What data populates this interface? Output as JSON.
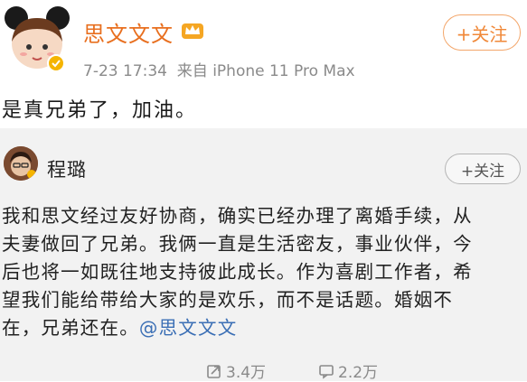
{
  "main_post": {
    "username": "思文文文",
    "follow_label": "+关注",
    "time": "7-23 17:34",
    "source": "来自 iPhone 11 Pro Max",
    "text": "是真兄弟了，加油。"
  },
  "repost": {
    "username": "程璐",
    "follow_label": "+关注",
    "lines": [
      "我和思文经过友好协商，确实已经办理了离婚手续，从",
      "夫妻做回了兄弟。我俩一直是生活密友，事业伙伴，今",
      "后也将一如既往地支持彼此成长。作为喜剧工作者，希",
      "望我们能给带给大家的是欢乐，而不是话题。婚姻不"
    ],
    "last_line_prefix": "在，兄弟还在。",
    "mention": "@思文文文",
    "share_count": "3.4万",
    "comment_count": "2.2万"
  },
  "colors": {
    "brand_orange": "#e86f1f",
    "mention_blue": "#3b6fb5",
    "meta_gray": "#8a8a8a"
  },
  "icons": [
    "vip-crown-icon",
    "share-icon",
    "comment-icon",
    "verified-badge-icon"
  ]
}
